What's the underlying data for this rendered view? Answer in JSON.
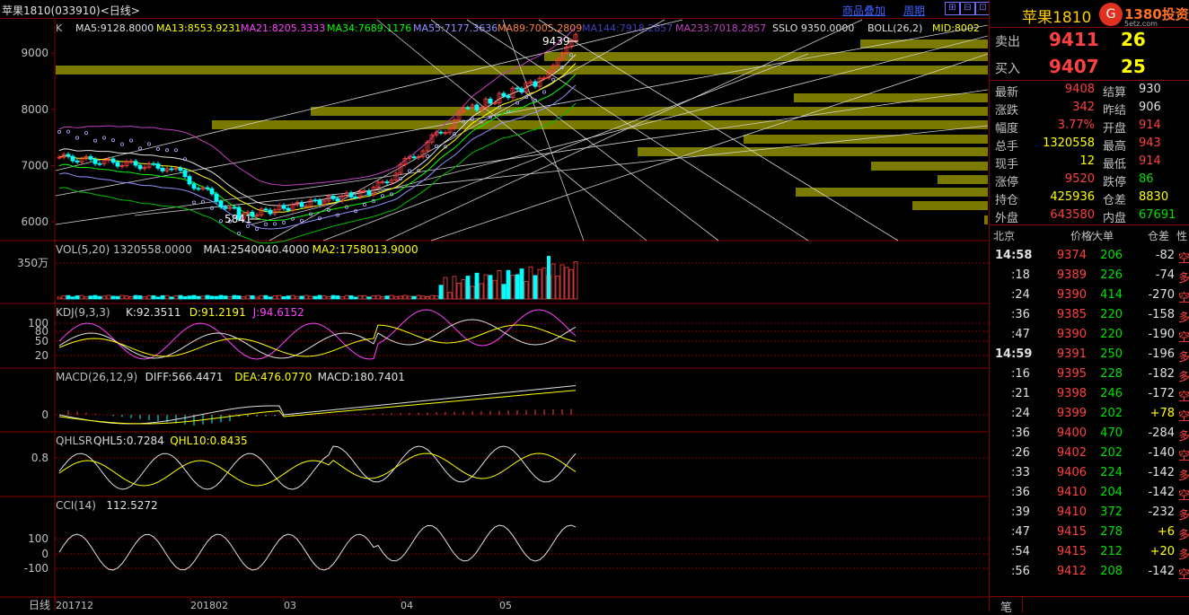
{
  "header": {
    "title": "苹果1810(033910)<日线>",
    "overlay_link": "商品叠加",
    "period_link": "周期"
  },
  "price_panel": {
    "ma_line": [
      {
        "label": "K",
        "color": "#c0c0c0"
      },
      {
        "label": "MA5:9128.8000",
        "color": "#e0e0e0"
      },
      {
        "label": "MA13:8553.9231",
        "color": "#ffff00"
      },
      {
        "label": "MA21:8205.3333",
        "color": "#ff40ff"
      },
      {
        "label": "MA34:7689.1176",
        "color": "#00ff00"
      },
      {
        "label": "MA55:7177.3636",
        "color": "#9090ff"
      },
      {
        "label": "MA89:7005.2809",
        "color": "#ff8040"
      },
      {
        "label": "MA144:7918.2857",
        "color": "#4040c0"
      },
      {
        "label": "MA233:7018.2857",
        "color": "#c040c0"
      },
      {
        "label": "SSLO 9350.0000",
        "color": "#e0e0e0"
      },
      {
        "label": "BOLL(26,2)",
        "color": "#e0e0e0"
      },
      {
        "label": "MID:8002",
        "color": "#ffff00"
      }
    ],
    "y_ticks": [
      "9000",
      "8000",
      "7000",
      "6000"
    ],
    "high_label": "9439",
    "low_label": "5841"
  },
  "volume_panel": {
    "label": "VOL(5,20) 1320558.0000 MA1:2540040.4000 MA2:1758013.9000",
    "label_parts": [
      {
        "text": "VOL(5,20) 1320558.0000",
        "color": "#c0c0c0"
      },
      {
        "text": "MA1:2540040.4000",
        "color": "#e0e0e0"
      },
      {
        "text": "MA2:1758013.9000",
        "color": "#ffff00"
      }
    ],
    "y_tick": "350万"
  },
  "kdj_panel": {
    "label_parts": [
      {
        "text": "KDJ(9,3,3)",
        "color": "#c0c0c0"
      },
      {
        "text": "K:92.3511",
        "color": "#e0e0e0"
      },
      {
        "text": "D:91.2191",
        "color": "#ffff00"
      },
      {
        "text": "J:94.6152",
        "color": "#ff40ff"
      }
    ],
    "y_ticks": [
      "100",
      "80",
      "50",
      "20"
    ]
  },
  "macd_panel": {
    "label_parts": [
      {
        "text": "MACD(26,12,9)",
        "color": "#c0c0c0"
      },
      {
        "text": "DIFF:566.4471",
        "color": "#e0e0e0"
      },
      {
        "text": "DEA:476.0770",
        "color": "#ffff00"
      },
      {
        "text": "MACD:180.7401",
        "color": "#e0e0e0"
      }
    ],
    "y_tick": "0"
  },
  "qhlsr_panel": {
    "label_parts": [
      {
        "text": "QHLSR",
        "color": "#c0c0c0"
      },
      {
        "text": "QHL5:0.7284",
        "color": "#e0e0e0"
      },
      {
        "text": "QHL10:0.8435",
        "color": "#ffff00"
      }
    ],
    "y_tick": "0.8"
  },
  "cci_panel": {
    "label_parts": [
      {
        "text": "CCI(14)",
        "color": "#c0c0c0"
      },
      {
        "text": "112.5272",
        "color": "#e0e0e0"
      }
    ],
    "y_ticks": [
      "100",
      "0",
      "-100"
    ]
  },
  "x_axis": {
    "period_label": "日线",
    "labels": [
      "201712",
      "201802",
      "03",
      "04",
      "05"
    ]
  },
  "quote": {
    "title": "苹果1810",
    "logo_text": "1380投资",
    "logo_sub": "5etz.com",
    "ask": {
      "label": "卖出",
      "price": "9411",
      "vol": "26"
    },
    "bid": {
      "label": "买入",
      "price": "9407",
      "vol": "25"
    },
    "stats": [
      {
        "l1": "最新",
        "v1": "9408",
        "c1": "red",
        "l2": "结算",
        "v2": "930",
        "c2": "white"
      },
      {
        "l1": "涨跌",
        "v1": "342",
        "c1": "red",
        "l2": "昨结",
        "v2": "906",
        "c2": "white"
      },
      {
        "l1": "幅度",
        "v1": "3.77%",
        "c1": "red",
        "l2": "开盘",
        "v2": "914",
        "c2": "red"
      },
      {
        "l1": "总手",
        "v1": "1320558",
        "c1": "yellow",
        "l2": "最高",
        "v2": "943",
        "c2": "red"
      },
      {
        "l1": "现手",
        "v1": "12",
        "c1": "yellow",
        "l2": "最低",
        "v2": "914",
        "c2": "red"
      },
      {
        "l1": "涨停",
        "v1": "9520",
        "c1": "red",
        "l2": "跌停",
        "v2": "86",
        "c2": "green"
      },
      {
        "l1": "持仓",
        "v1": "425936",
        "c1": "yellow",
        "l2": "仓差",
        "v2": "8830",
        "c2": "yellow"
      },
      {
        "l1": "外盘",
        "v1": "643580",
        "c1": "red",
        "l2": "内盘",
        "v2": "67691",
        "c2": "green"
      }
    ],
    "tick_headers": [
      "北京",
      "价格",
      "⁄大单",
      "仓差",
      "性"
    ],
    "ticks": [
      {
        "time": "14:58",
        "price": "9374",
        "vol": "206",
        "diff": "-82",
        "nat": "空",
        "nc": "red"
      },
      {
        "time": ":18",
        "price": "9389",
        "vol": "226",
        "diff": "-74",
        "nat": "多",
        "nc": "red"
      },
      {
        "time": ":24",
        "price": "9390",
        "vol": "414",
        "diff": "-270",
        "nat": "空",
        "nc": "red"
      },
      {
        "time": ":36",
        "price": "9385",
        "vol": "220",
        "diff": "-158",
        "nat": "多",
        "nc": "red"
      },
      {
        "time": ":47",
        "price": "9390",
        "vol": "220",
        "diff": "-190",
        "nat": "空",
        "nc": "red"
      },
      {
        "time": "14:59",
        "price": "9391",
        "vol": "250",
        "diff": "-196",
        "nat": "多",
        "nc": "red"
      },
      {
        "time": ":16",
        "price": "9395",
        "vol": "228",
        "diff": "-182",
        "nat": "多",
        "nc": "red"
      },
      {
        "time": ":21",
        "price": "9398",
        "vol": "246",
        "diff": "-172",
        "nat": "空",
        "nc": "red"
      },
      {
        "time": ":24",
        "price": "9399",
        "vol": "202",
        "diff": "+78",
        "nat": "空",
        "nc": "red"
      },
      {
        "time": ":36",
        "price": "9400",
        "vol": "470",
        "diff": "-284",
        "nat": "多",
        "nc": "red"
      },
      {
        "time": ":26",
        "price": "9402",
        "vol": "202",
        "diff": "-140",
        "nat": "空",
        "nc": "red"
      },
      {
        "time": ":33",
        "price": "9406",
        "vol": "224",
        "diff": "-142",
        "nat": "多",
        "nc": "red"
      },
      {
        "time": ":36",
        "price": "9410",
        "vol": "204",
        "diff": "-142",
        "nat": "空",
        "nc": "red"
      },
      {
        "time": ":39",
        "price": "9410",
        "vol": "372",
        "diff": "-232",
        "nat": "多",
        "nc": "red"
      },
      {
        "time": ":47",
        "price": "9415",
        "vol": "278",
        "diff": "+6",
        "nat": "多",
        "nc": "red"
      },
      {
        "time": ":54",
        "price": "9415",
        "vol": "212",
        "diff": "+20",
        "nat": "多",
        "nc": "red"
      },
      {
        "time": ":56",
        "price": "9412",
        "vol": "208",
        "diff": "-142",
        "nat": "空",
        "nc": "red"
      }
    ],
    "footer": "笔"
  }
}
